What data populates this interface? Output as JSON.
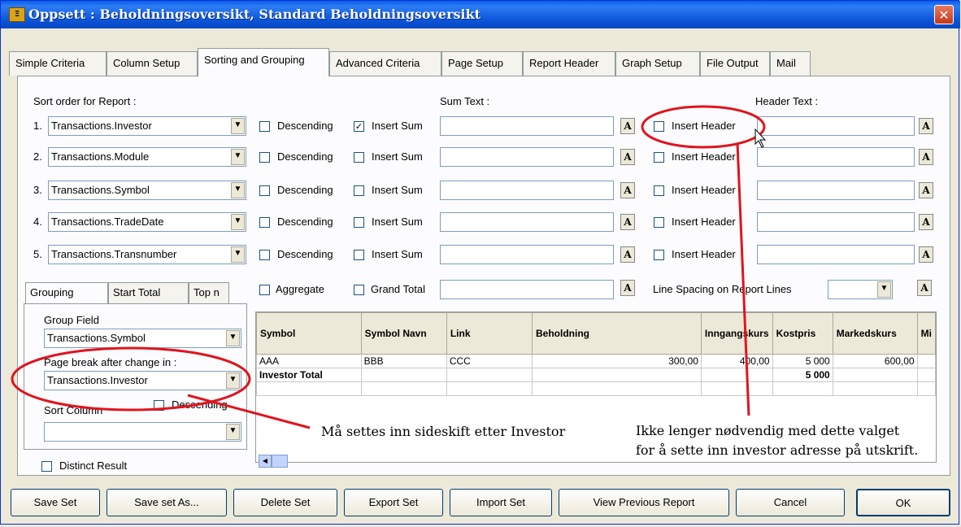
{
  "window": {
    "title": "Oppsett : Beholdningsoversikt, Standard Beholdningsoversikt",
    "close_label": "✕",
    "icon_label": "Ξ"
  },
  "tabs": [
    "Simple Criteria",
    "Column Setup",
    "Sorting and Grouping",
    "Advanced Criteria",
    "Page Setup",
    "Report Header",
    "Graph Setup",
    "File Output",
    "Mail"
  ],
  "sort": {
    "title": "Sort order for Report :",
    "sum_text_label": "Sum Text :",
    "header_text_label": "Header Text :",
    "descending_label": "Descending",
    "insert_sum_label": "Insert Sum",
    "insert_header_label": "Insert Header",
    "a_label": "A",
    "check_mark": "✓",
    "rows": [
      {
        "num": "1.",
        "field": "Transactions.Investor",
        "insert_sum": true
      },
      {
        "num": "2.",
        "field": "Transactions.Module",
        "insert_sum": false
      },
      {
        "num": "3.",
        "field": "Transactions.Symbol",
        "insert_sum": false
      },
      {
        "num": "4.",
        "field": "Transactions.TradeDate",
        "insert_sum": false
      },
      {
        "num": "5.",
        "field": "Transactions.Transnumber",
        "insert_sum": false
      }
    ]
  },
  "options": {
    "aggregate": "Aggregate",
    "grand_total": "Grand Total",
    "line_spacing": "Line Spacing on Report Lines"
  },
  "grouping": {
    "tabs": [
      "Grouping",
      "Start Total",
      "Top n"
    ],
    "group_field_label": "Group Field",
    "group_field_value": "Transactions.Symbol",
    "page_break_label": "Page break after change in :",
    "page_break_value": "Transactions.Investor",
    "sort_column_label": "Sort Column",
    "descending_label": "Descending",
    "distinct_label": "Distinct Result"
  },
  "grid": {
    "headers": [
      "Symbol",
      "Symbol Navn",
      "Link",
      "Beholdning",
      "Inngangskurs",
      "Kostpris",
      "Markedskurs",
      "Mi"
    ],
    "rows": [
      [
        "AAA",
        "BBB",
        "CCC",
        "300,00",
        "400,00",
        "5 000",
        "600,00",
        ""
      ],
      [
        "Investor Total",
        "",
        "",
        "",
        "",
        "5 000",
        "",
        ""
      ]
    ]
  },
  "annotations": {
    "left": "Må settes inn sideskift etter Investor",
    "right_line1": "Ikke lenger nødvendig med dette valget",
    "right_line2": "for å sette inn investor adresse på utskrift."
  },
  "buttons": [
    "Save Set",
    "Save set As...",
    "Delete Set",
    "Export Set",
    "Import Set",
    "View Previous Report",
    "Cancel",
    "OK"
  ],
  "colors": {
    "annotation": "#e0141e",
    "title_bar": "#0a5ee8"
  }
}
